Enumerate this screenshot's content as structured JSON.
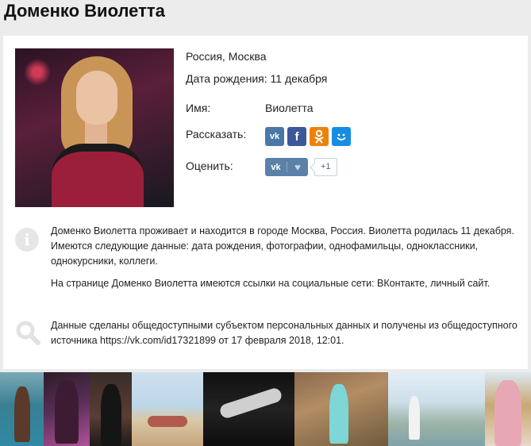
{
  "page": {
    "title": "Доменко Виолетта"
  },
  "profile": {
    "location": "Россия, Москва",
    "birthday": "Дата рождения: 11 декабря",
    "name_label": "Имя:",
    "name_value": "Виолетта",
    "share_label": "Рассказать:",
    "rate_label": "Оценить:",
    "like_brand": "vk",
    "like_count": "+1"
  },
  "share": {
    "vk": "vk",
    "facebook": "f",
    "odnoklassniki": "ok",
    "mailru": "mail.ru"
  },
  "about": {
    "paragraph1": "Доменко Виолетта проживает и находится в городе Москва, Россия. Виолетта родилась 11 декабря. Имеются следующие данные: дата рождения, фотографии, однофамильцы, одноклассники, однокурсники, коллеги.",
    "paragraph2": "На странице Доменко Виолетта имеются ссылки на социальные сети: ВКонтакте, личный сайт.",
    "source": "Данные сделаны общедоступными субъектом персональных данных и получены из общедоступного источника https://vk.com/id17321899 от 17 февраля 2018, 12:01."
  },
  "icons": {
    "info": "info-icon",
    "search": "search-icon"
  },
  "colors": {
    "vk": "#4a76a8",
    "facebook": "#3b5998",
    "odnoklassniki": "#ee8208",
    "mailru": "#168de2"
  }
}
